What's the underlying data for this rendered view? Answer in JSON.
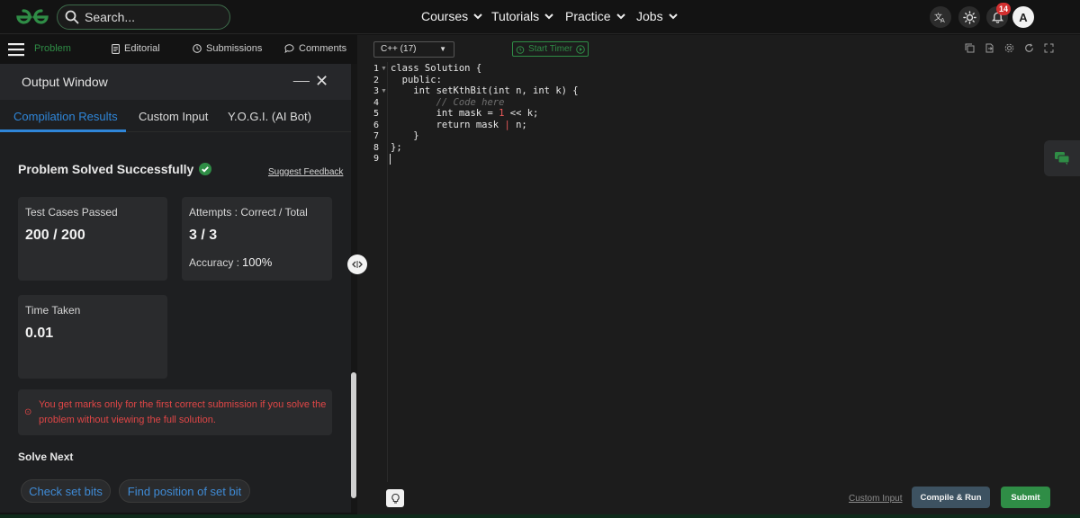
{
  "header": {
    "search_placeholder": "Search...",
    "nav": [
      {
        "label": "Courses"
      },
      {
        "label": "Tutorials"
      },
      {
        "label": "Practice"
      },
      {
        "label": "Jobs"
      }
    ],
    "notifications_count": "14",
    "avatar_initial": "A"
  },
  "problem_tabs": [
    {
      "label": "Problem",
      "active": true
    },
    {
      "label": "Editorial"
    },
    {
      "label": "Submissions"
    },
    {
      "label": "Comments"
    }
  ],
  "output_window": {
    "title": "Output Window",
    "tabs": [
      "Compilation Results",
      "Custom Input",
      "Y.O.G.I. (AI Bot)"
    ],
    "status": "Problem Solved Successfully",
    "feedback_link": "Suggest Feedback",
    "test_cases_label": "Test Cases Passed",
    "test_cases_value": "200 / 200",
    "attempts_label": "Attempts : Correct / Total",
    "attempts_value": "3 / 3",
    "accuracy_label": "Accuracy :",
    "accuracy_value": "100%",
    "time_label": "Time Taken",
    "time_value": "0.01",
    "warning": "You get marks only for the first correct submission if you solve the problem without viewing the full solution.",
    "solve_next_label": "Solve Next",
    "solve_next": [
      "Check set bits",
      "Find position of set bit"
    ]
  },
  "editor": {
    "language": "C++ (17)",
    "timer_label": "Start Timer",
    "line_numbers": [
      "1",
      "2",
      "3",
      "4",
      "5",
      "6",
      "7",
      "8",
      "9"
    ],
    "code": {
      "l1": "class Solution {",
      "l2": "  public:",
      "l3": "    int setKthBit(int n, int k) {",
      "l4": "        // Code here",
      "l5a": "        int mask = ",
      "l5b": "1",
      "l5c": " << ",
      "l5d": "k;",
      "l6a": "        return mask ",
      "l6b": "|",
      "l6c": " n;",
      "l7": "    }",
      "l8": "};",
      "l9": ""
    },
    "custom_input_label": "Custom Input",
    "compile_run_label": "Compile & Run",
    "submit_label": "Submit"
  },
  "colors": {
    "brand_green": "#2f8d46",
    "link_blue": "#2f86d9",
    "warning_red": "#e04646"
  }
}
